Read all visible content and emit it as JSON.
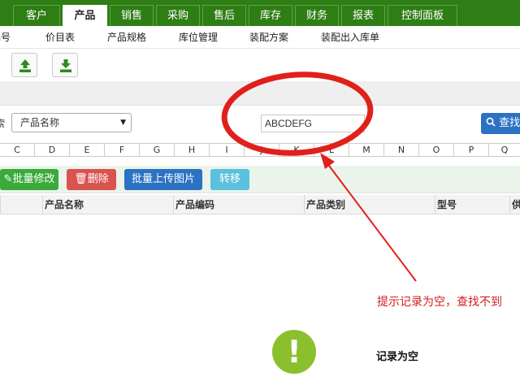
{
  "main_nav": {
    "tabs": [
      "客户",
      "产品",
      "销售",
      "采购",
      "售后",
      "库存",
      "财务",
      "报表",
      "控制面板"
    ],
    "active": "产品"
  },
  "sub_nav": {
    "items": [
      "编号",
      "价目表",
      "产品规格",
      "库位管理",
      "装配方案",
      "装配出入库单"
    ]
  },
  "toolbar": {
    "import_icon": "upload-icon",
    "export_icon": "download-icon"
  },
  "search": {
    "left_label_cut": "索",
    "field_select_value": "产品名称",
    "keyword_value": "ABCDEFG",
    "search_button_label": "查找",
    "search_icon": "search-icon"
  },
  "letter_filter": [
    "C",
    "D",
    "E",
    "F",
    "G",
    "H",
    "I",
    "J",
    "K",
    "L",
    "M",
    "N",
    "O",
    "P",
    "Q"
  ],
  "actions": {
    "bulk_edit": "批量修改",
    "delete": "删除",
    "bulk_upload_images": "批量上传图片",
    "transfer": "转移"
  },
  "table": {
    "columns": [
      "产品名称",
      "产品编码",
      "产品类别",
      "型号",
      "供"
    ]
  },
  "annotation": {
    "text": "提示记录为空，查找不到",
    "color": "#d21d1d"
  },
  "dialog": {
    "message": "记录为空",
    "icon": "exclamation-icon"
  },
  "colors": {
    "nav_green": "#2e7d15",
    "action_green": "#3aaa3a",
    "delete_red": "#d9534f",
    "primary_blue": "#2b72c2",
    "light_blue": "#5bc0de",
    "warn_green": "#8cbf2e"
  }
}
